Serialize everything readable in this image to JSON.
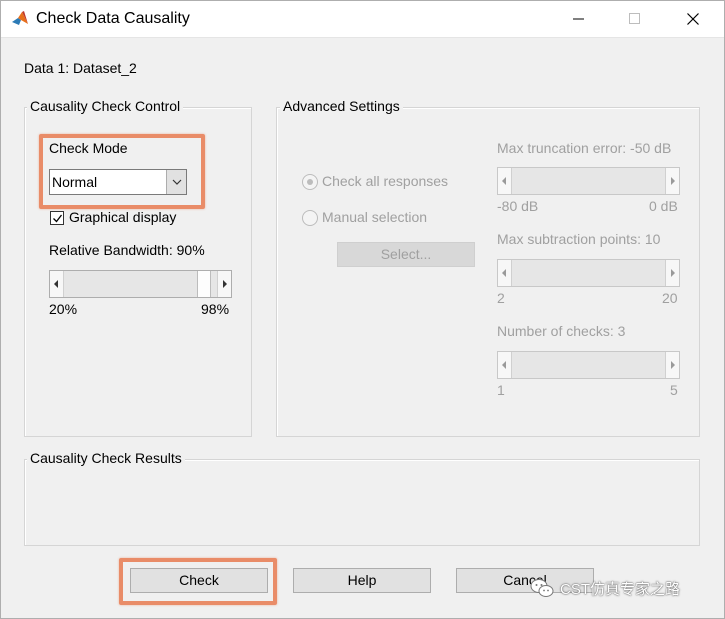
{
  "window": {
    "title": "Check Data Causality"
  },
  "data_label": "Data 1: Dataset_2",
  "control_group": {
    "title": "Causality Check Control",
    "check_mode_label": "Check Mode",
    "check_mode_value": "Normal",
    "graphical_display_label": "Graphical display",
    "graphical_display_checked": true,
    "bandwidth_label": "Relative Bandwidth: 90%",
    "bandwidth_min": "20%",
    "bandwidth_max": "98%",
    "bandwidth_level": 0.9
  },
  "advanced_group": {
    "title": "Advanced Settings",
    "check_all_label": "Check all responses",
    "manual_label": "Manual selection",
    "select_button": "Select...",
    "selected_radio": "check_all",
    "max_truncation": {
      "label": "Max truncation error: -50 dB",
      "min": "-80 dB",
      "max": "0 dB",
      "value": -50
    },
    "max_subtraction": {
      "label": "Max subtraction points: 10",
      "min": "2",
      "max": "20",
      "value": 10
    },
    "num_checks": {
      "label": "Number of checks: 3",
      "min": "1",
      "max": "5",
      "value": 3
    }
  },
  "results_group": {
    "title": "Causality Check Results"
  },
  "buttons": {
    "check": "Check",
    "help": "Help",
    "cancel": "Cancel"
  },
  "watermark": "CST仿真专家之路",
  "colors": {
    "highlight": "#e98c68",
    "disabled_text": "#a0a0a0"
  },
  "icons": {
    "app": "matlab-icon",
    "minimize": "minimize-icon",
    "maximize": "maximize-icon",
    "close": "close-icon",
    "dropdown": "chevron-down-icon",
    "watermark": "wechat-icon"
  }
}
